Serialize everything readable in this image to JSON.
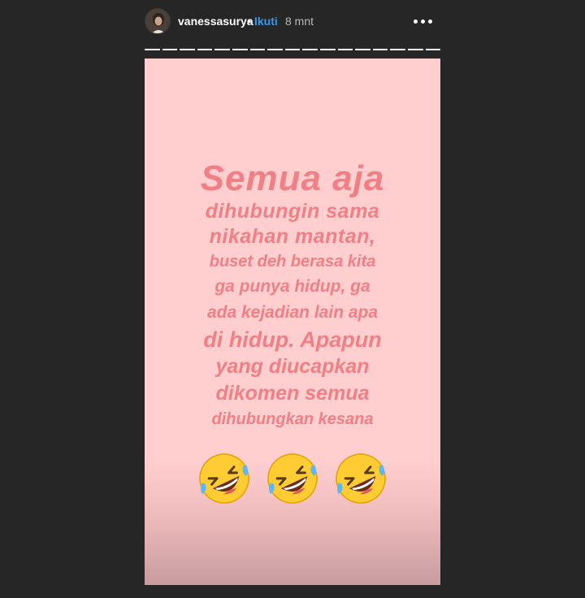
{
  "header": {
    "username": "vanessasurya",
    "separator": "•",
    "follow_label": "Ikuti",
    "time": "8 mnt",
    "more_icon": "more-horizontal-icon"
  },
  "progress": {
    "segments": 17,
    "completed": 17
  },
  "story": {
    "background_color": "#ffcfd0",
    "text_color": "#f07f86",
    "lines": [
      "Semua aja",
      "dihubungin sama",
      "nikahan mantan,",
      "buset deh berasa kita",
      "ga punya hidup, ga",
      "ada kejadian lain apa",
      "di hidup. Apapun",
      "yang diucapkan",
      "dikomen semua",
      "dihubungkan kesana"
    ],
    "emojis": [
      "rolling-on-floor-laughing-icon",
      "rolling-on-floor-laughing-icon",
      "rolling-on-floor-laughing-icon"
    ]
  }
}
